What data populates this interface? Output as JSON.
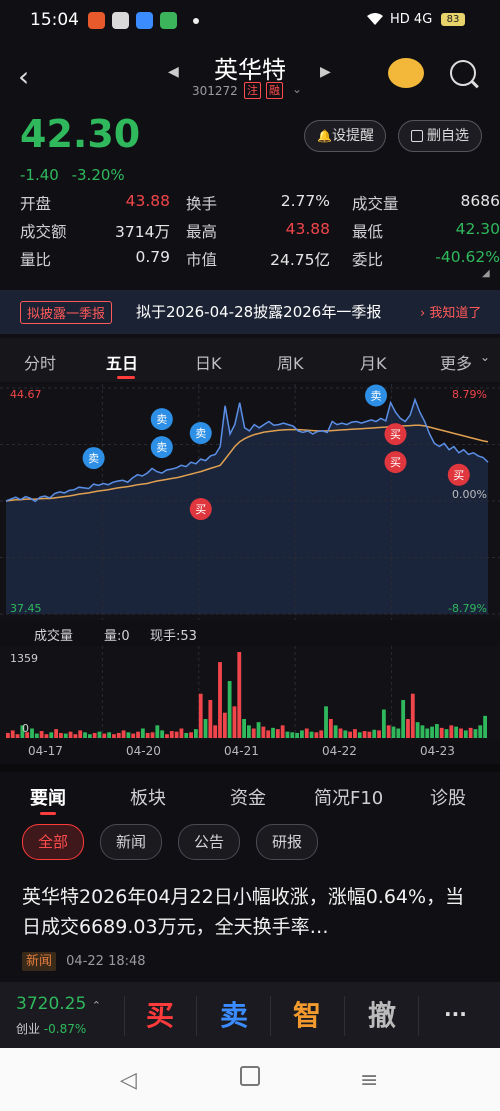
{
  "status_bar": {
    "time": "15:04",
    "network": "HD 4G",
    "battery": "83"
  },
  "header": {
    "title": "英华特",
    "code": "301272",
    "tag1": "注",
    "tag2": "融"
  },
  "quote": {
    "price": "42.30",
    "change": "-1.40",
    "change_pct": "-3.20%",
    "btn_alert": "设提醒",
    "btn_remove": "删自选"
  },
  "stats": [
    [
      {
        "label": "开盘",
        "value": "43.88",
        "color": "red"
      },
      {
        "label": "换手",
        "value": "2.77%",
        "color": ""
      },
      {
        "label": "成交量",
        "value": "8686",
        "color": ""
      }
    ],
    [
      {
        "label": "成交额",
        "value": "3714万",
        "color": ""
      },
      {
        "label": "最高",
        "value": "43.88",
        "color": "red"
      },
      {
        "label": "最低",
        "value": "42.30",
        "color": "green"
      }
    ],
    [
      {
        "label": "量比",
        "value": "0.79",
        "color": ""
      },
      {
        "label": "市值",
        "value": "24.75亿",
        "color": ""
      },
      {
        "label": "委比",
        "value": "-40.62%",
        "color": "green"
      }
    ]
  ],
  "banner": {
    "tag": "拟披露一季报",
    "text": "拟于2026-04-28披露2026年一季报",
    "ok": "我知道了"
  },
  "chart_tabs": [
    "分时",
    "五日",
    "日K",
    "周K",
    "月K",
    "更多"
  ],
  "chart_data": {
    "type": "line",
    "title": "",
    "y_left": {
      "max": "44.67",
      "min": "37.45"
    },
    "y_right": {
      "max": "8.79%",
      "zero": "0.00%",
      "min": "-8.79%"
    },
    "ylim": [
      37.45,
      44.67
    ],
    "prev_close": 41.06,
    "x": [
      "04-17",
      "04-20",
      "04-21",
      "04-22",
      "04-23"
    ],
    "price_series": [
      41.06,
      41.12,
      41.18,
      41.1,
      41.2,
      41.15,
      41.05,
      41.18,
      41.22,
      41.16,
      41.3,
      41.35,
      41.32,
      41.4,
      41.42,
      41.5,
      41.48,
      41.46,
      41.6,
      41.56,
      41.62,
      41.58,
      41.66,
      41.7,
      41.72,
      41.66,
      41.8,
      41.9,
      41.86,
      41.95,
      42.1,
      42.0,
      41.95,
      42.05,
      42.08,
      42.12,
      42.2,
      42.16,
      42.3,
      42.25,
      42.4,
      42.35,
      42.5,
      42.55,
      42.8,
      44.1,
      43.2,
      43.5,
      44.2,
      43.4,
      43.3,
      43.5,
      43.4,
      43.5,
      43.6,
      43.48,
      43.5,
      43.55,
      43.5,
      43.45,
      43.3,
      43.25,
      43.3,
      43.2,
      43.28,
      43.3,
      43.25,
      43.6,
      43.5,
      43.55,
      43.5,
      43.58,
      43.6,
      43.55,
      43.6,
      43.65,
      43.6,
      43.7,
      43.62,
      44.2,
      43.9,
      43.7,
      43.6,
      43.8,
      44.3,
      43.9,
      43.6,
      43.2,
      42.9,
      42.8,
      42.9,
      42.7,
      42.8,
      42.6,
      42.7,
      42.55,
      42.6,
      42.5,
      42.45,
      42.3
    ],
    "avg_series": [
      41.06,
      41.08,
      41.1,
      41.1,
      41.12,
      41.12,
      41.12,
      41.13,
      41.14,
      41.14,
      41.16,
      41.18,
      41.2,
      41.22,
      41.25,
      41.28,
      41.3,
      41.32,
      41.35,
      41.38,
      41.4,
      41.42,
      41.45,
      41.48,
      41.5,
      41.52,
      41.55,
      41.58,
      41.6,
      41.62,
      41.66,
      41.7,
      41.72,
      41.75,
      41.78,
      41.8,
      41.84,
      41.88,
      41.92,
      41.96,
      42.0,
      42.05,
      42.1,
      42.15,
      42.2,
      42.4,
      42.6,
      42.8,
      42.95,
      43.05,
      43.12,
      43.18,
      43.22,
      43.26,
      43.28,
      43.3,
      43.32,
      43.33,
      43.34,
      43.34,
      43.34,
      43.33,
      43.32,
      43.31,
      43.3,
      43.3,
      43.3,
      43.31,
      43.32,
      43.33,
      43.34,
      43.35,
      43.36,
      43.37,
      43.38,
      43.39,
      43.4,
      43.41,
      43.42,
      43.45,
      43.46,
      43.46,
      43.46,
      43.47,
      43.48,
      43.48,
      43.46,
      43.42,
      43.38,
      43.34,
      43.3,
      43.26,
      43.22,
      43.18,
      43.14,
      43.1,
      43.06,
      43.02,
      42.98,
      42.95
    ],
    "markers": [
      {
        "label": "卖",
        "type": "sell",
        "i": 18
      },
      {
        "label": "卖",
        "type": "sell",
        "i": 32
      },
      {
        "label": "卖",
        "type": "sell",
        "i": 32
      },
      {
        "label": "卖",
        "type": "sell",
        "i": 40
      },
      {
        "label": "买",
        "type": "buy",
        "i": 40
      },
      {
        "label": "卖",
        "type": "sell",
        "i": 76
      },
      {
        "label": "买",
        "type": "buy",
        "i": 80
      },
      {
        "label": "买",
        "type": "buy",
        "i": 80
      },
      {
        "label": "买",
        "type": "buy",
        "i": 93
      }
    ]
  },
  "volume": {
    "label": "成交量",
    "vol_label": "量:0",
    "cur_label": "现手:53",
    "max_label": "1359",
    "min_label": "0",
    "max": 1359,
    "bars": [
      80,
      120,
      60,
      200,
      90,
      150,
      70,
      110,
      60,
      90,
      140,
      80,
      70,
      100,
      60,
      120,
      90,
      60,
      80,
      100,
      70,
      90,
      60,
      80,
      120,
      90,
      70,
      100,
      150,
      80,
      90,
      200,
      120,
      60,
      110,
      100,
      150,
      80,
      90,
      140,
      700,
      300,
      600,
      200,
      1200,
      400,
      900,
      500,
      1359,
      300,
      200,
      150,
      250,
      180,
      120,
      160,
      140,
      200,
      100,
      90,
      80,
      120,
      150,
      100,
      90,
      120,
      500,
      300,
      200,
      150,
      120,
      100,
      140,
      90,
      110,
      100,
      130,
      120,
      450,
      200,
      180,
      150,
      600,
      300,
      700,
      250,
      200,
      150,
      180,
      220,
      160,
      140,
      200,
      180,
      150,
      120,
      160,
      140,
      200,
      350
    ]
  },
  "news_tabs": [
    "要闻",
    "板块",
    "资金",
    "简况F10",
    "诊股"
  ],
  "news_chips": [
    "全部",
    "新闻",
    "公告",
    "研报"
  ],
  "news_item": {
    "headline": "英华特2026年04月22日小幅收涨，涨幅0.64%，当日成交6689.03万元，全天换手率…",
    "tag": "新闻",
    "time": "04-22 18:48"
  },
  "bottom_bar": {
    "index_value": "3720.25",
    "index_name": "创业",
    "index_change": "-0.87%",
    "buy": "买",
    "sell": "卖",
    "smart": "智",
    "cancel": "撤",
    "more": "···"
  },
  "colors": {
    "up": "#f0454a",
    "down": "#2fb85c",
    "price_line": "#5b8fe6",
    "avg_line": "#e0a050"
  }
}
